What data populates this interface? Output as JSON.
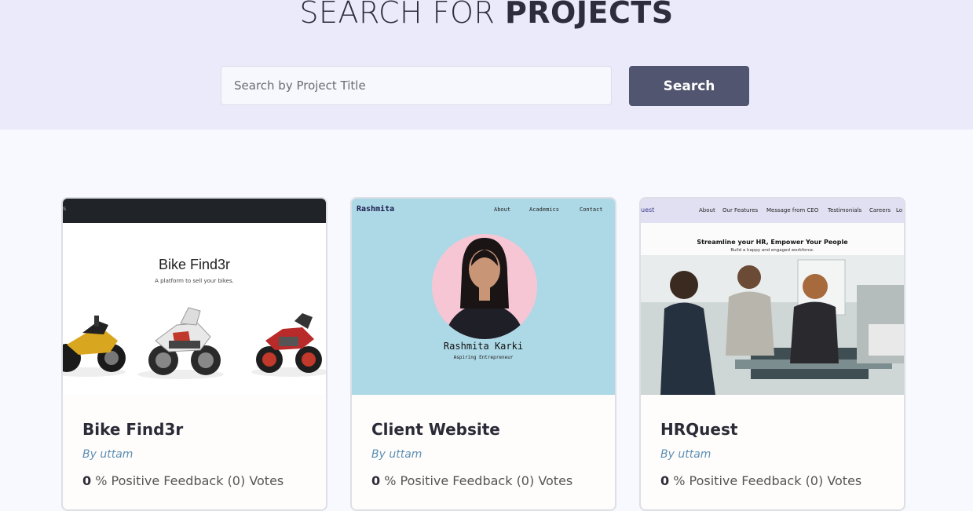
{
  "hero": {
    "title_light": "SEARCH FOR ",
    "title_bold": "PROJECTS",
    "search_placeholder": "Search by Project Title",
    "search_button": "Search"
  },
  "projects": [
    {
      "title": "Bike Find3r",
      "author": "By uttam",
      "feedback_value": "0",
      "feedback_text": " % Positive Feedback (0) Votes",
      "thumbnail": {
        "nav_fragment": "s",
        "heading": "Bike Find3r",
        "subheading": "A platform to sell your bikes."
      }
    },
    {
      "title": "Client Website",
      "author": "By uttam",
      "feedback_value": "0",
      "feedback_text": " % Positive Feedback (0) Votes",
      "thumbnail": {
        "brand": "Rashmita",
        "nav": [
          "About",
          "Academics",
          "Contact"
        ],
        "name": "Rashmita Karki",
        "role": "Aspiring Entrepreneur"
      }
    },
    {
      "title": "HRQuest",
      "author": "By uttam",
      "feedback_value": "0",
      "feedback_text": " % Positive Feedback (0) Votes",
      "thumbnail": {
        "brand": "uest",
        "nav": [
          "About",
          "Our Features",
          "Message from CEO",
          "Testimonials",
          "Careers",
          "Lo"
        ],
        "headline": "Streamline your HR, Empower Your People",
        "subheadline": "Build a happy and engaged workforce."
      }
    }
  ]
}
